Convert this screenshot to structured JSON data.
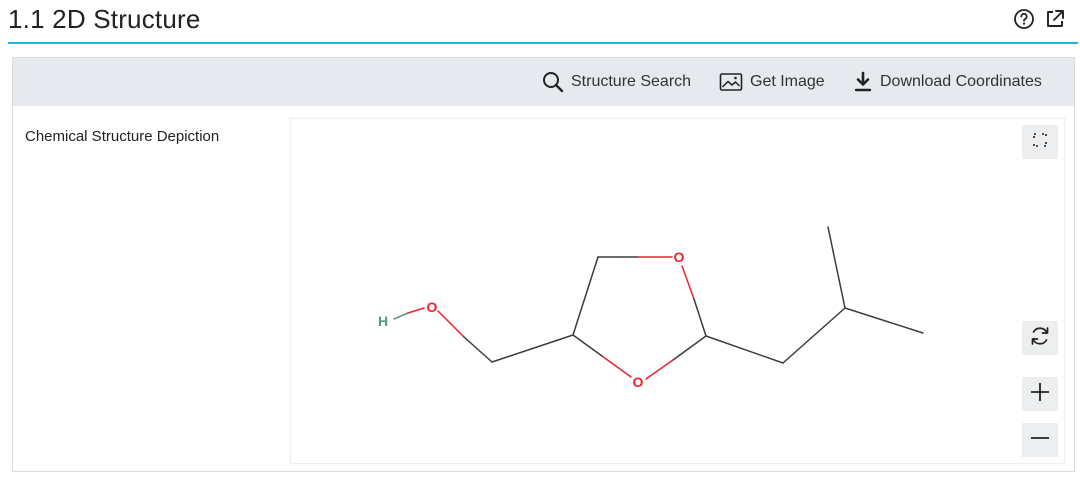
{
  "section": {
    "title": "1.1 2D Structure",
    "help_icon": "help-circle-icon",
    "popout_icon": "external-link-icon"
  },
  "toolbar": {
    "structure_search_label": "Structure Search",
    "get_image_label": "Get Image",
    "download_coordinates_label": "Download Coordinates"
  },
  "content": {
    "label": "Chemical Structure Depiction"
  },
  "viewer": {
    "fullscreen_icon": "fullscreen-icon",
    "reset_icon": "refresh-icon",
    "zoom_in_icon": "plus-icon",
    "zoom_out_icon": "minus-icon"
  },
  "molecule": {
    "atom_labels": {
      "hydrogen": "H",
      "oxygen_hydroxyl": "O",
      "oxygen_ring_top": "O",
      "oxygen_ring_bottom": "O"
    },
    "colors": {
      "bond": "#3c3c3c",
      "oxygen": "#e8232c",
      "hydrogen": "#5f9584"
    }
  },
  "colors": {
    "accent": "#1fb3d4",
    "toolbar_bg": "#e6e9ed"
  }
}
